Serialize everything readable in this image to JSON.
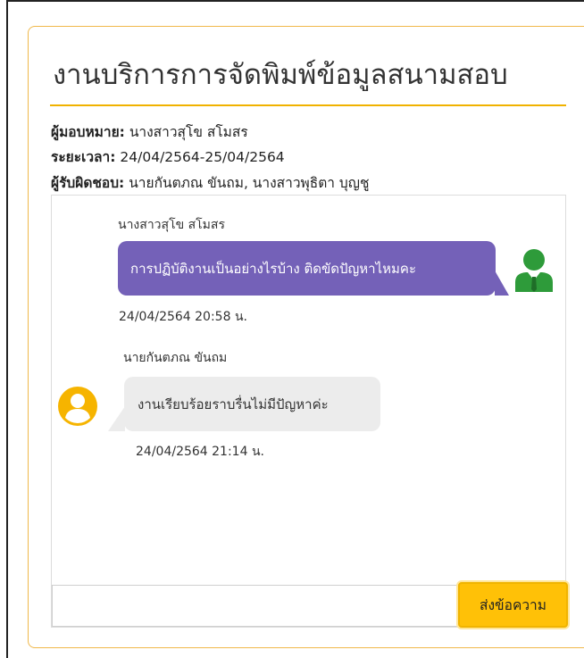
{
  "page": {
    "title": "งานบริการการจัดพิมพ์ข้อมูลสนามสอบ",
    "accent_color": "#f0b200"
  },
  "meta": {
    "assigner_label": "ผู้มอบหมาย:",
    "assigner_value": "นางสาวสุโข สโมสร",
    "period_label": "ระยะเวลา:",
    "period_value": "24/04/2564-25/04/2564",
    "responsible_label": "ผู้รับผิดชอบ:",
    "responsible_value": "นายกันตภณ ขันถม, นางสาวพุธิตา บุญชู"
  },
  "chat": {
    "messages": [
      {
        "sender": "นางสาวสุโข สโมสร",
        "text": "การปฏิบัติงานเป็นอย่างไรบ้าง ติดขัดปัญหาไหมคะ",
        "time": "24/04/2564 20:58 น.",
        "direction": "outgoing",
        "bubble_color": "#7461b8",
        "avatar_icon": "user-tie-icon",
        "avatar_color": "#2e9b3a"
      },
      {
        "sender": "นายกันตภณ ขันถม",
        "text": "งานเรียบร้อยราบรื่นไม่มีปัญหาค่ะ",
        "time": "24/04/2564 21:14 น.",
        "direction": "incoming",
        "bubble_color": "#ececec",
        "avatar_icon": "user-circle-icon",
        "avatar_color": "#f6b400"
      }
    ]
  },
  "composer": {
    "input_value": "",
    "input_placeholder": "",
    "send_label": "ส่งข้อความ",
    "send_color": "#ffc107"
  }
}
